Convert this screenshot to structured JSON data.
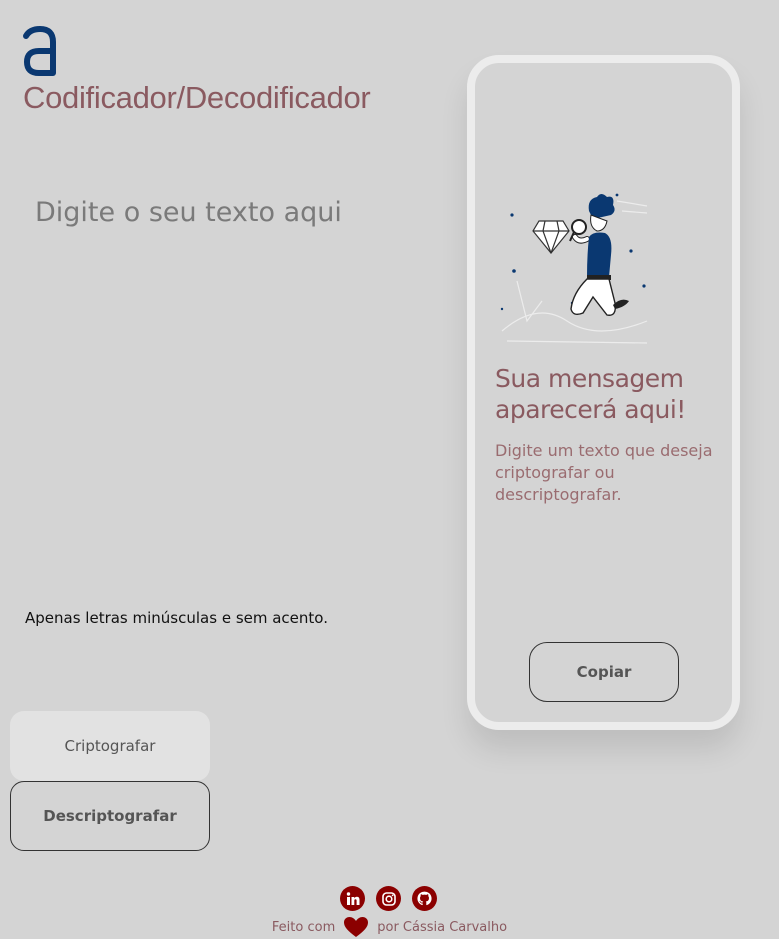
{
  "header": {
    "title": "Codificador/Decodificador",
    "logo_icon": "alura-a-logo-icon"
  },
  "editor": {
    "placeholder": "Digite o seu texto aqui",
    "value": ""
  },
  "hint": "Apenas letras minúsculas e sem acento.",
  "buttons": {
    "encrypt": "Criptografar",
    "decrypt": "Descriptografar"
  },
  "output": {
    "title": "Sua mensagem aparecerá aqui!",
    "subtitle": "Digite um texto que deseja criptografar ou descriptografar.",
    "copy": "Copiar",
    "illustration_icon": "person-magnifier-diamond-illustration"
  },
  "footer": {
    "made_with": "Feito com",
    "by": "por Cássia Carvalho",
    "heart_icon": "heart-icon",
    "social": [
      "linkedin-icon",
      "instagram-icon",
      "github-icon"
    ]
  },
  "colors": {
    "background": "#d4d4d4",
    "accent": "#8a5a60",
    "logo": "#0a3871",
    "social": "#8b0000"
  }
}
